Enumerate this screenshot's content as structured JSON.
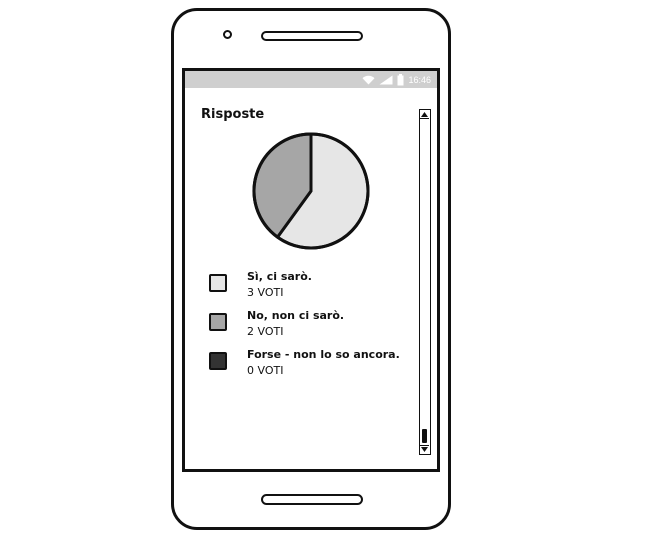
{
  "statusbar": {
    "time": "16:46",
    "icons": [
      "wifi-icon",
      "signal-icon",
      "battery-icon"
    ]
  },
  "page": {
    "title": "Risposte"
  },
  "poll": {
    "options": [
      {
        "label": "Sì, ci sarò.",
        "votes_text": "3 VOTI",
        "votes": 3,
        "color": "#e6e6e6"
      },
      {
        "label": "No, non ci sarò.",
        "votes_text": "2 VOTI",
        "votes": 2,
        "color": "#a6a6a6"
      },
      {
        "label": "Forse - non lo so ancora.",
        "votes_text": "0 VOTI",
        "votes": 0,
        "color": "#333333"
      }
    ]
  },
  "chart_data": {
    "type": "pie",
    "categories": [
      "Sì, ci sarò.",
      "No, non ci sarò.",
      "Forse - non lo so ancora."
    ],
    "values": [
      3,
      2,
      0
    ],
    "colors": [
      "#e6e6e6",
      "#a6a6a6",
      "#333333"
    ]
  }
}
